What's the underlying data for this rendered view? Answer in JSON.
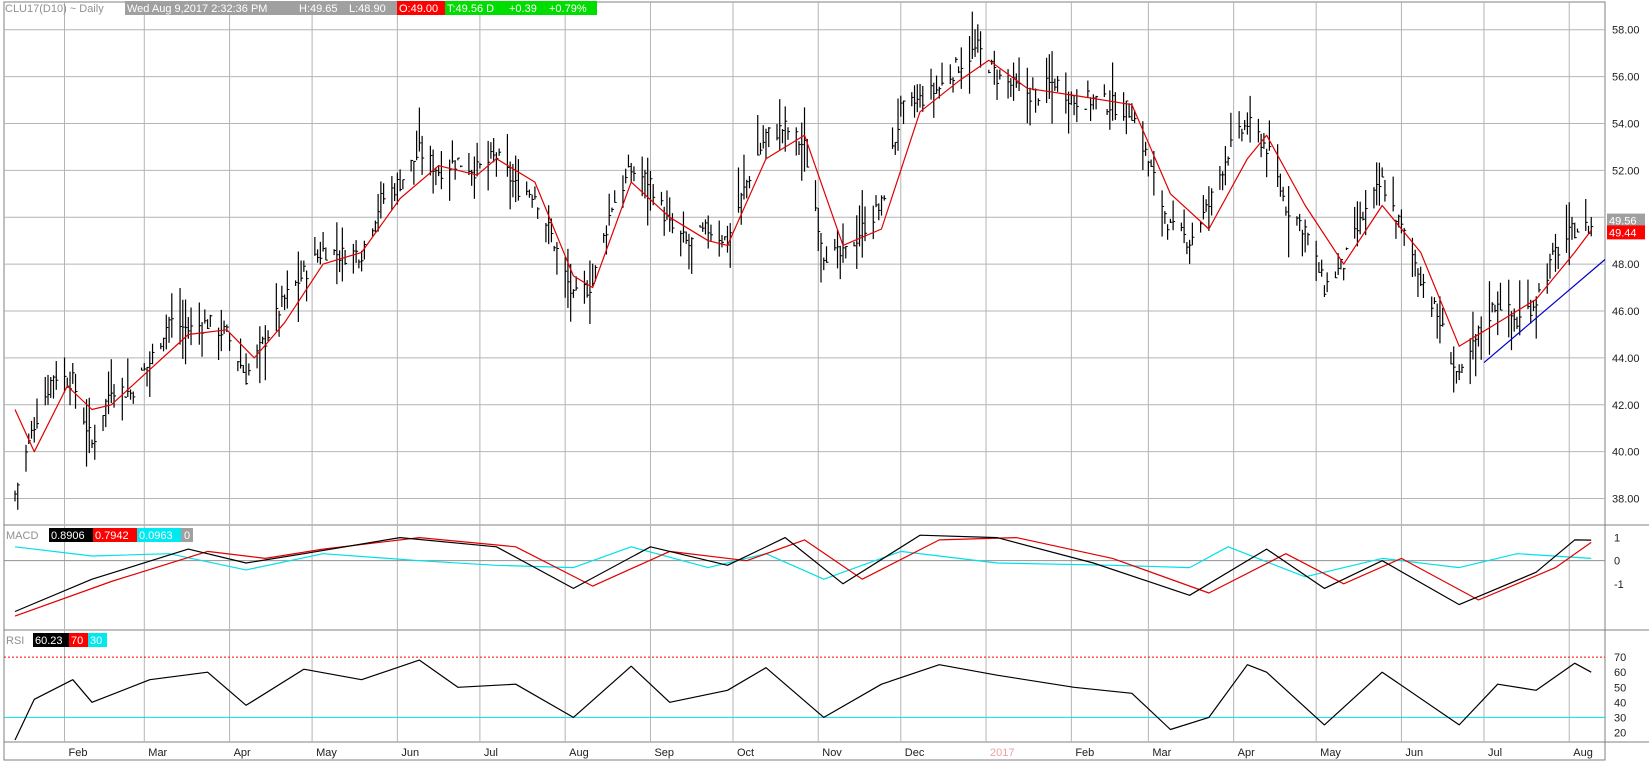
{
  "header": {
    "symbol": "CLU17(D10) ~ Daily",
    "info": "Wed Aug 9,2017 2:32:36 PM",
    "high": "H:49.65",
    "low": "L:48.90",
    "open": "O:49.00",
    "last": "T:49.56 D",
    "change": "+0.39",
    "pct": "+0.79%"
  },
  "colors": {
    "bar": "#000000",
    "ma": "#e00000",
    "trend": "#0000c8",
    "signal_cyan": "#00e0e8",
    "grid": "#b4b4b4",
    "label_red_bg": "#ff0000",
    "label_green_bg": "#00dd00",
    "label_gray_bg": "#a0a0a0"
  },
  "chart_data": [
    {
      "type": "ohlc",
      "title": "CLU17(D10) ~ Daily",
      "x_ticks": [
        "Feb",
        "Mar",
        "Apr",
        "May",
        "Jun",
        "Jul",
        "Aug",
        "Sep",
        "Oct",
        "Nov",
        "Dec",
        "2017",
        "Feb",
        "Mar",
        "Apr",
        "May",
        "Jun",
        "Jul",
        "Aug"
      ],
      "y_ticks": [
        "58.00",
        "56.00",
        "54.00",
        "52.00",
        "50.00",
        "48.00",
        "46.00",
        "44.00",
        "42.00",
        "40.00",
        "38.00"
      ],
      "ylim": [
        37,
        58.5
      ],
      "last_price_label": "49.56",
      "ma_label": "49.44",
      "close_points": [
        [
          "2016-01-14",
          38.2
        ],
        [
          "2016-01-21",
          41.2
        ],
        [
          "2016-01-28",
          43.3
        ],
        [
          "2016-02-04",
          43.0
        ],
        [
          "2016-02-11",
          40.3
        ],
        [
          "2016-02-18",
          42.8
        ],
        [
          "2016-02-25",
          42.5
        ],
        [
          "2016-03-03",
          43.8
        ],
        [
          "2016-03-10",
          45.6
        ],
        [
          "2016-03-17",
          45.2
        ],
        [
          "2016-03-24",
          45.5
        ],
        [
          "2016-03-31",
          45.0
        ],
        [
          "2016-04-07",
          43.2
        ],
        [
          "2016-04-14",
          44.8
        ],
        [
          "2016-04-21",
          46.5
        ],
        [
          "2016-04-28",
          47.6
        ],
        [
          "2016-05-05",
          48.6
        ],
        [
          "2016-05-12",
          48.4
        ],
        [
          "2016-05-19",
          48.5
        ],
        [
          "2016-05-26",
          50.7
        ],
        [
          "2016-06-02",
          51.5
        ],
        [
          "2016-06-09",
          52.8
        ],
        [
          "2016-06-16",
          52.0
        ],
        [
          "2016-06-23",
          52.4
        ],
        [
          "2016-06-30",
          52.0
        ],
        [
          "2016-07-07",
          52.6
        ],
        [
          "2016-07-14",
          51.3
        ],
        [
          "2016-07-21",
          51.0
        ],
        [
          "2016-07-28",
          48.9
        ],
        [
          "2016-08-04",
          46.5
        ],
        [
          "2016-08-11",
          47.2
        ],
        [
          "2016-08-18",
          50.5
        ],
        [
          "2016-08-25",
          52.0
        ],
        [
          "2016-09-01",
          51.5
        ],
        [
          "2016-09-08",
          49.6
        ],
        [
          "2016-09-15",
          48.8
        ],
        [
          "2016-09-22",
          49.5
        ],
        [
          "2016-09-29",
          49.0
        ],
        [
          "2016-10-06",
          51.5
        ],
        [
          "2016-10-13",
          53.5
        ],
        [
          "2016-10-20",
          53.8
        ],
        [
          "2016-10-27",
          53.0
        ],
        [
          "2016-11-03",
          48.5
        ],
        [
          "2016-11-10",
          48.3
        ],
        [
          "2016-11-17",
          49.5
        ],
        [
          "2016-11-24",
          50.5
        ],
        [
          "2016-12-01",
          54.5
        ],
        [
          "2016-12-08",
          55.0
        ],
        [
          "2016-12-15",
          55.5
        ],
        [
          "2016-12-22",
          56.5
        ],
        [
          "2016-12-29",
          57.2
        ],
        [
          "2017-01-05",
          56.0
        ],
        [
          "2017-01-12",
          55.5
        ],
        [
          "2017-01-19",
          55.2
        ],
        [
          "2017-01-26",
          55.8
        ],
        [
          "2017-02-02",
          55.0
        ],
        [
          "2017-02-09",
          55.0
        ],
        [
          "2017-02-16",
          54.8
        ],
        [
          "2017-02-23",
          54.5
        ],
        [
          "2017-03-02",
          52.0
        ],
        [
          "2017-03-09",
          49.5
        ],
        [
          "2017-03-16",
          49.0
        ],
        [
          "2017-03-23",
          50.5
        ],
        [
          "2017-03-30",
          52.8
        ],
        [
          "2017-04-06",
          54.0
        ],
        [
          "2017-04-13",
          53.0
        ],
        [
          "2017-04-20",
          50.5
        ],
        [
          "2017-04-27",
          49.5
        ],
        [
          "2017-05-04",
          47.0
        ],
        [
          "2017-05-11",
          48.0
        ],
        [
          "2017-05-18",
          50.0
        ],
        [
          "2017-05-25",
          51.5
        ],
        [
          "2017-06-01",
          49.5
        ],
        [
          "2017-06-08",
          47.5
        ],
        [
          "2017-06-15",
          45.5
        ],
        [
          "2017-06-22",
          43.0
        ],
        [
          "2017-06-29",
          45.0
        ],
        [
          "2017-07-06",
          46.5
        ],
        [
          "2017-07-13",
          45.5
        ],
        [
          "2017-07-20",
          46.5
        ],
        [
          "2017-07-27",
          48.5
        ],
        [
          "2017-08-03",
          49.5
        ],
        [
          "2017-08-09",
          49.56
        ]
      ],
      "ma_points": [
        [
          "2016-01-14",
          41.8
        ],
        [
          "2016-01-21",
          40.0
        ],
        [
          "2016-02-02",
          42.8
        ],
        [
          "2016-02-11",
          41.8
        ],
        [
          "2016-02-18",
          42.0
        ],
        [
          "2016-03-03",
          43.5
        ],
        [
          "2016-03-17",
          45.0
        ],
        [
          "2016-03-31",
          45.2
        ],
        [
          "2016-04-10",
          44.0
        ],
        [
          "2016-04-21",
          45.5
        ],
        [
          "2016-05-05",
          48.0
        ],
        [
          "2016-05-19",
          48.5
        ],
        [
          "2016-06-02",
          50.8
        ],
        [
          "2016-06-16",
          52.2
        ],
        [
          "2016-06-30",
          51.8
        ],
        [
          "2016-07-07",
          52.5
        ],
        [
          "2016-07-21",
          51.5
        ],
        [
          "2016-08-04",
          47.5
        ],
        [
          "2016-08-11",
          47.0
        ],
        [
          "2016-08-25",
          51.5
        ],
        [
          "2016-09-08",
          50.0
        ],
        [
          "2016-09-22",
          49.0
        ],
        [
          "2016-09-29",
          48.8
        ],
        [
          "2016-10-13",
          52.5
        ],
        [
          "2016-10-27",
          53.5
        ],
        [
          "2016-11-10",
          48.8
        ],
        [
          "2016-11-24",
          49.5
        ],
        [
          "2016-12-08",
          54.5
        ],
        [
          "2016-12-22",
          55.8
        ],
        [
          "2017-01-02",
          56.7
        ],
        [
          "2017-01-16",
          55.5
        ],
        [
          "2017-02-02",
          55.2
        ],
        [
          "2017-02-23",
          54.8
        ],
        [
          "2017-03-09",
          51.0
        ],
        [
          "2017-03-23",
          49.5
        ],
        [
          "2017-04-06",
          52.5
        ],
        [
          "2017-04-13",
          53.5
        ],
        [
          "2017-04-27",
          50.5
        ],
        [
          "2017-05-11",
          48.0
        ],
        [
          "2017-05-25",
          50.5
        ],
        [
          "2017-06-08",
          48.5
        ],
        [
          "2017-06-22",
          44.5
        ],
        [
          "2017-07-06",
          45.5
        ],
        [
          "2017-07-20",
          46.5
        ],
        [
          "2017-08-03",
          48.5
        ],
        [
          "2017-08-09",
          49.44
        ]
      ],
      "trendline": [
        [
          "2017-07-01",
          43.8
        ],
        [
          "2017-08-14",
          48.2
        ]
      ]
    },
    {
      "type": "line",
      "title": "MACD",
      "values_shown": [
        "0.8906",
        "0.7942",
        "0.0963",
        "0"
      ],
      "y_ticks": [
        "1",
        "0",
        "-1"
      ],
      "ylim": [
        -3,
        1.5
      ],
      "series": [
        {
          "values": [
            [
              "2016-01-14",
              -2.2
            ],
            [
              "2016-02-11",
              -0.8
            ],
            [
              "2016-03-17",
              0.5
            ],
            [
              "2016-04-07",
              -0.1
            ],
            [
              "2016-04-28",
              0.3
            ],
            [
              "2016-06-02",
              1.0
            ],
            [
              "2016-07-07",
              0.6
            ],
            [
              "2016-08-04",
              -1.2
            ],
            [
              "2016-09-01",
              0.6
            ],
            [
              "2016-09-29",
              -0.2
            ],
            [
              "2016-10-20",
              1.0
            ],
            [
              "2016-11-10",
              -1.0
            ],
            [
              "2016-12-08",
              1.1
            ],
            [
              "2017-01-05",
              1.0
            ],
            [
              "2017-02-09",
              -0.1
            ],
            [
              "2017-03-16",
              -1.5
            ],
            [
              "2017-04-13",
              0.5
            ],
            [
              "2017-05-04",
              -1.2
            ],
            [
              "2017-05-25",
              0.0
            ],
            [
              "2017-06-22",
              -1.9
            ],
            [
              "2017-07-20",
              -0.5
            ],
            [
              "2017-08-03",
              0.9
            ],
            [
              "2017-08-09",
              0.89
            ]
          ]
        },
        {
          "values": [
            [
              "2016-01-14",
              -2.4
            ],
            [
              "2016-02-18",
              -0.9
            ],
            [
              "2016-03-24",
              0.4
            ],
            [
              "2016-04-14",
              0.1
            ],
            [
              "2016-05-05",
              0.5
            ],
            [
              "2016-06-09",
              1.0
            ],
            [
              "2016-07-14",
              0.6
            ],
            [
              "2016-08-11",
              -1.1
            ],
            [
              "2016-09-08",
              0.4
            ],
            [
              "2016-10-06",
              0.0
            ],
            [
              "2016-10-27",
              0.9
            ],
            [
              "2016-11-17",
              -0.8
            ],
            [
              "2016-12-15",
              0.9
            ],
            [
              "2017-01-12",
              1.0
            ],
            [
              "2017-02-16",
              0.1
            ],
            [
              "2017-03-23",
              -1.4
            ],
            [
              "2017-04-20",
              0.3
            ],
            [
              "2017-05-11",
              -1.0
            ],
            [
              "2017-06-01",
              0.1
            ],
            [
              "2017-06-29",
              -1.7
            ],
            [
              "2017-07-27",
              -0.3
            ],
            [
              "2017-08-09",
              0.79
            ]
          ]
        },
        {
          "values": [
            [
              "2016-01-14",
              0.6
            ],
            [
              "2016-02-11",
              0.2
            ],
            [
              "2016-03-10",
              0.3
            ],
            [
              "2016-04-07",
              -0.4
            ],
            [
              "2016-05-05",
              0.3
            ],
            [
              "2016-06-09",
              0.0
            ],
            [
              "2016-07-07",
              -0.2
            ],
            [
              "2016-08-04",
              -0.3
            ],
            [
              "2016-08-25",
              0.6
            ],
            [
              "2016-09-22",
              -0.3
            ],
            [
              "2016-10-13",
              0.3
            ],
            [
              "2016-11-03",
              -0.8
            ],
            [
              "2016-12-01",
              0.4
            ],
            [
              "2017-01-05",
              -0.1
            ],
            [
              "2017-02-16",
              -0.2
            ],
            [
              "2017-03-16",
              -0.3
            ],
            [
              "2017-03-30",
              0.6
            ],
            [
              "2017-04-27",
              -0.7
            ],
            [
              "2017-05-25",
              0.1
            ],
            [
              "2017-06-22",
              -0.3
            ],
            [
              "2017-07-13",
              0.3
            ],
            [
              "2017-08-09",
              0.1
            ]
          ]
        }
      ]
    },
    {
      "type": "line",
      "title": "RSI",
      "values_shown": [
        "60.23",
        "70",
        "30"
      ],
      "y_ticks": [
        "70",
        "60",
        "50",
        "40",
        "30",
        "20"
      ],
      "ylim": [
        15,
        88
      ],
      "series": [
        {
          "values": [
            [
              "2016-01-14",
              15
            ],
            [
              "2016-01-21",
              42
            ],
            [
              "2016-02-04",
              55
            ],
            [
              "2016-02-11",
              40
            ],
            [
              "2016-03-03",
              55
            ],
            [
              "2016-03-24",
              60
            ],
            [
              "2016-04-07",
              38
            ],
            [
              "2016-04-28",
              62
            ],
            [
              "2016-05-19",
              55
            ],
            [
              "2016-06-09",
              68
            ],
            [
              "2016-06-23",
              50
            ],
            [
              "2016-07-14",
              52
            ],
            [
              "2016-08-04",
              30
            ],
            [
              "2016-08-25",
              64
            ],
            [
              "2016-09-08",
              40
            ],
            [
              "2016-09-29",
              48
            ],
            [
              "2016-10-13",
              63
            ],
            [
              "2016-11-03",
              30
            ],
            [
              "2016-11-24",
              52
            ],
            [
              "2016-12-15",
              65
            ],
            [
              "2017-01-05",
              58
            ],
            [
              "2017-02-02",
              50
            ],
            [
              "2017-02-23",
              46
            ],
            [
              "2017-03-09",
              22
            ],
            [
              "2017-03-23",
              30
            ],
            [
              "2017-04-06",
              65
            ],
            [
              "2017-04-13",
              60
            ],
            [
              "2017-05-04",
              25
            ],
            [
              "2017-05-25",
              60
            ],
            [
              "2017-06-22",
              25
            ],
            [
              "2017-07-06",
              52
            ],
            [
              "2017-07-20",
              48
            ],
            [
              "2017-08-03",
              66
            ],
            [
              "2017-08-09",
              60
            ]
          ]
        }
      ]
    }
  ]
}
